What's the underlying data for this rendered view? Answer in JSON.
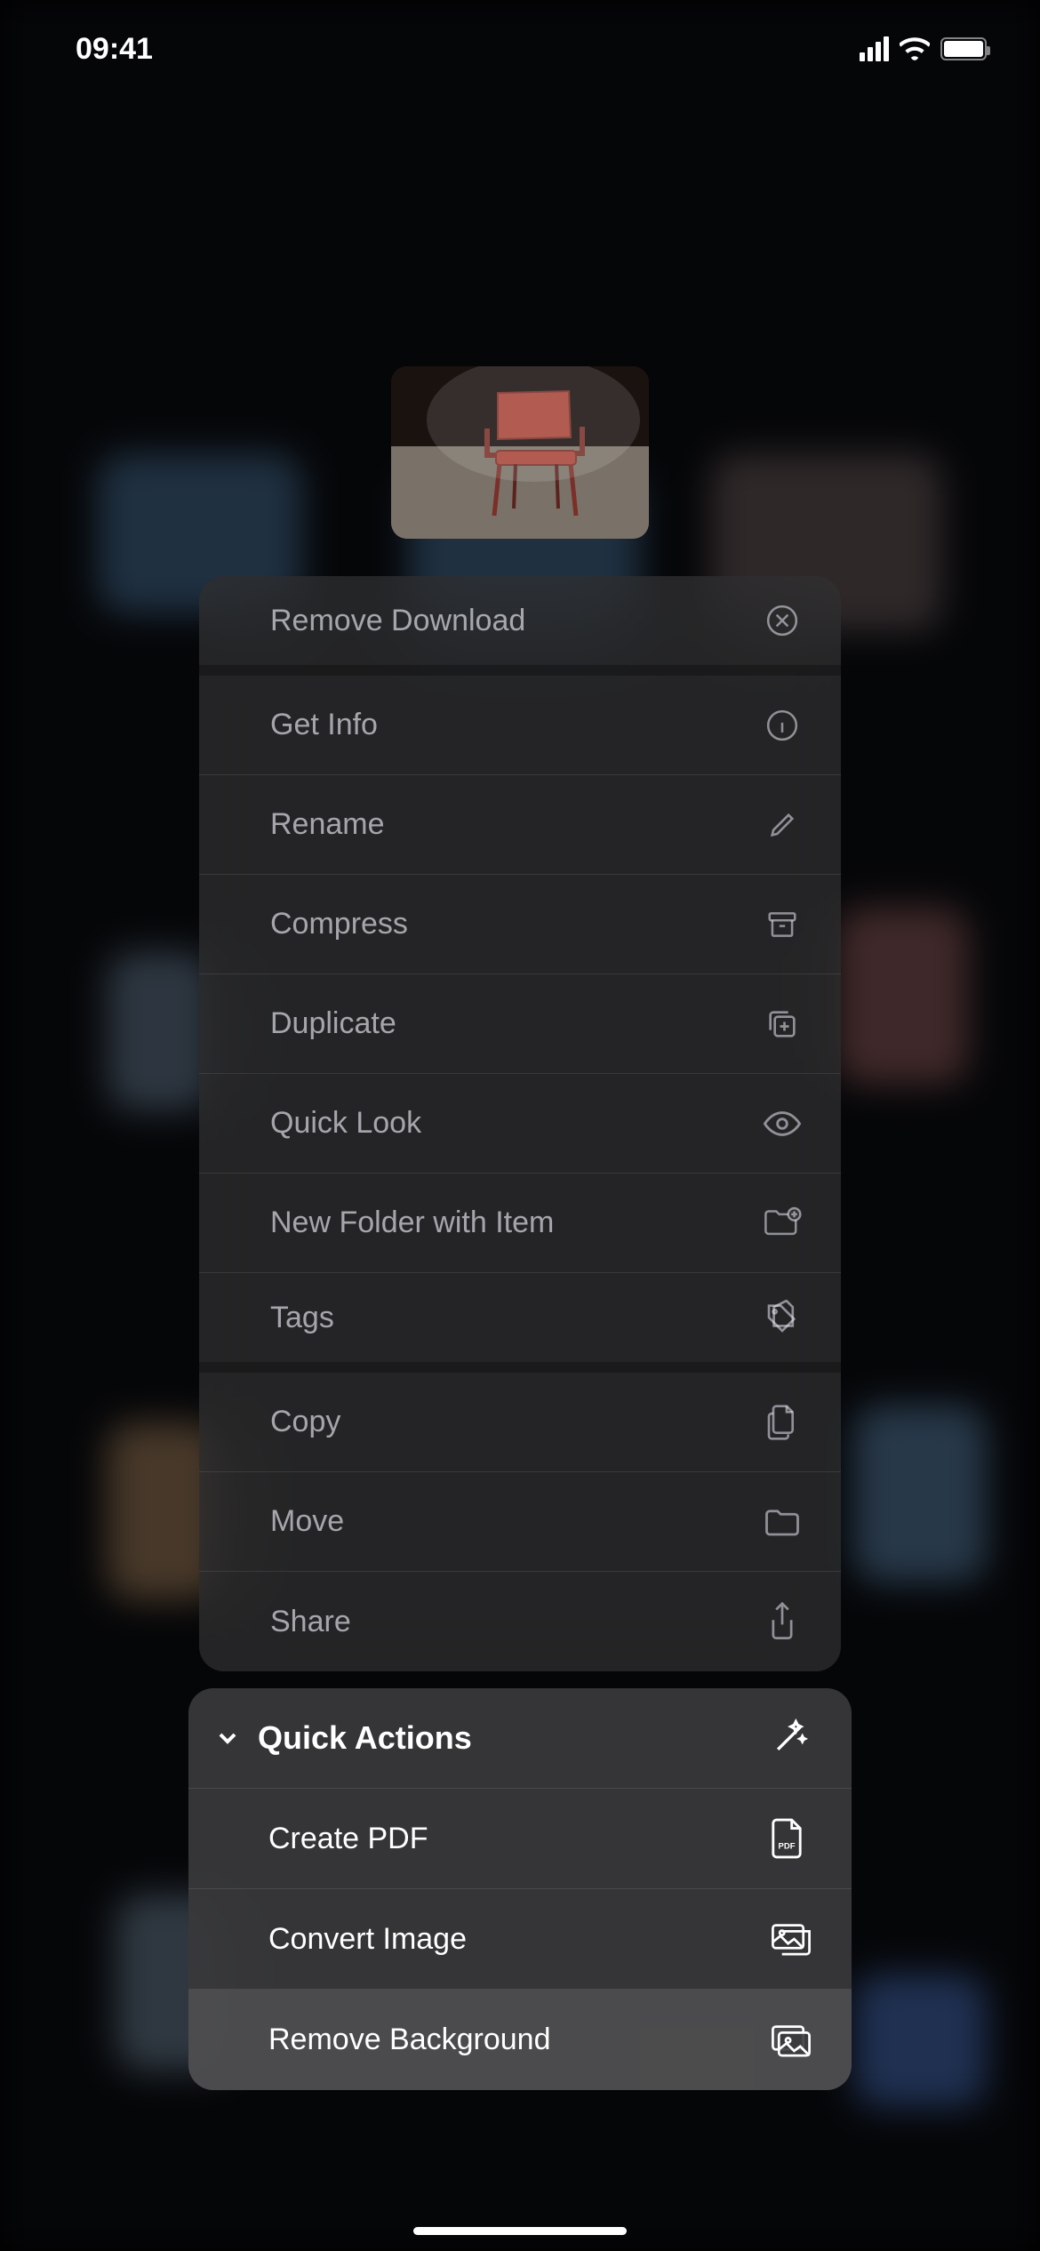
{
  "status": {
    "time": "09:41"
  },
  "menu": {
    "items": [
      {
        "label": "Remove Download",
        "icon": "xmark-circle"
      },
      {
        "label": "Get Info",
        "icon": "info-circle"
      },
      {
        "label": "Rename",
        "icon": "pencil"
      },
      {
        "label": "Compress",
        "icon": "archivebox"
      },
      {
        "label": "Duplicate",
        "icon": "plus-square-on-square"
      },
      {
        "label": "Quick Look",
        "icon": "eye"
      },
      {
        "label": "New Folder with Item",
        "icon": "folder-badge-plus"
      },
      {
        "label": "Tags",
        "icon": "tag"
      },
      {
        "label": "Copy",
        "icon": "doc-on-doc"
      },
      {
        "label": "Move",
        "icon": "folder"
      },
      {
        "label": "Share",
        "icon": "square-arrow-up"
      }
    ]
  },
  "quick_actions": {
    "title": "Quick Actions",
    "items": [
      {
        "label": "Create PDF",
        "icon": "doc-pdf"
      },
      {
        "label": "Convert Image",
        "icon": "photo-stack"
      },
      {
        "label": "Remove Background",
        "icon": "photo-bg"
      }
    ]
  }
}
